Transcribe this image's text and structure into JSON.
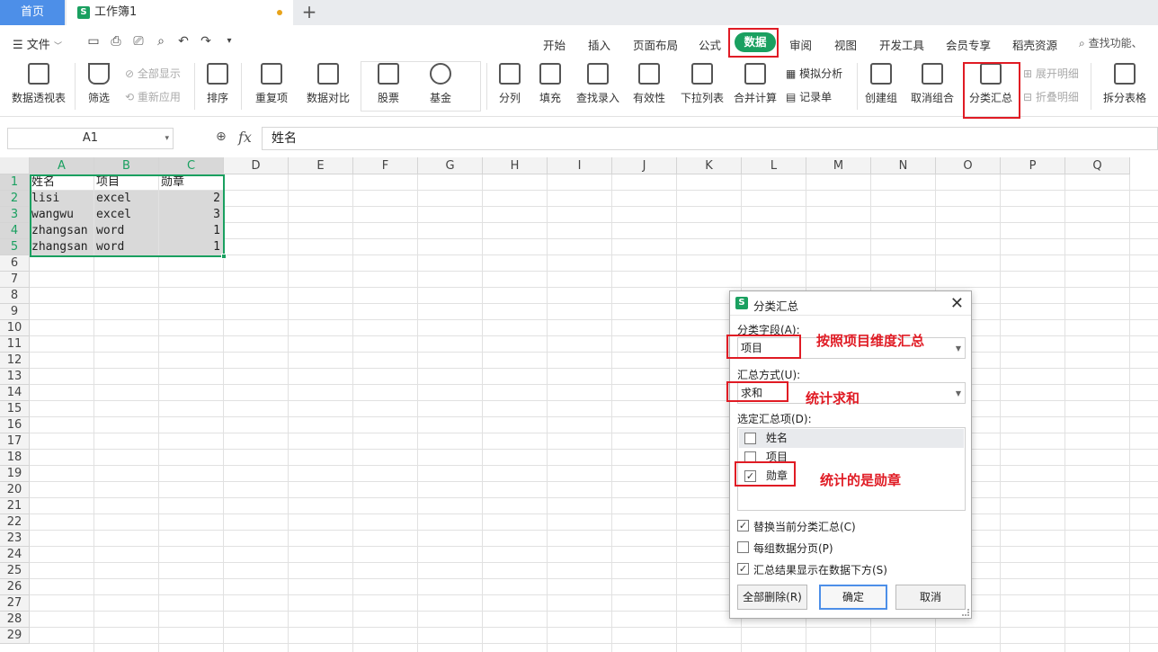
{
  "tabs": {
    "home": "首页",
    "doc": "工作簿1"
  },
  "menu": {
    "file": "文件",
    "tabs": [
      "开始",
      "插入",
      "页面布局",
      "公式",
      "数据",
      "审阅",
      "视图",
      "开发工具",
      "会员专享",
      "稻壳资源"
    ],
    "active_tab": "数据",
    "search": "查找功能、"
  },
  "ribbon": {
    "pivot": "数据透视表",
    "filter": "筛选",
    "show_all": "全部显示",
    "reapply": "重新应用",
    "sort": "排序",
    "dup": "重复项",
    "compare": "数据对比",
    "stock": "股票",
    "fund": "基金",
    "split": "分列",
    "fill": "填充",
    "lookup": "查找录入",
    "validity": "有效性",
    "dropdown": "下拉列表",
    "merge_calc": "合并计算",
    "simulate": "模拟分析",
    "record": "记录单",
    "group": "创建组",
    "ungroup": "取消组合",
    "subtotal": "分类汇总",
    "expand": "展开明细",
    "collapse": "折叠明细",
    "split_table": "拆分表格"
  },
  "formula": {
    "cell_ref": "A1",
    "fx": "fx",
    "value": "姓名"
  },
  "grid": {
    "columns": [
      "A",
      "B",
      "C",
      "D",
      "E",
      "F",
      "G",
      "H",
      "I",
      "J",
      "K",
      "L",
      "M",
      "N",
      "O",
      "P",
      "Q"
    ],
    "rows": [
      "1",
      "2",
      "3",
      "4",
      "5",
      "6",
      "7",
      "8",
      "9",
      "10",
      "11",
      "12",
      "13",
      "14",
      "15",
      "16",
      "17",
      "18",
      "19",
      "20",
      "21",
      "22",
      "23",
      "24",
      "25",
      "26",
      "27",
      "28",
      "29"
    ],
    "data": [
      [
        "姓名",
        "项目",
        "勋章"
      ],
      [
        "lisi",
        "excel",
        "2"
      ],
      [
        "wangwu",
        "excel",
        "3"
      ],
      [
        "zhangsan",
        "word",
        "1"
      ],
      [
        "zhangsan",
        "word",
        "1"
      ]
    ]
  },
  "dialog": {
    "title": "分类汇总",
    "field_label": "分类字段(A):",
    "field_value": "项目",
    "method_label": "汇总方式(U):",
    "method_value": "求和",
    "items_label": "选定汇总项(D):",
    "items": [
      {
        "label": "姓名",
        "checked": false
      },
      {
        "label": "项目",
        "checked": false
      },
      {
        "label": "勋章",
        "checked": true
      }
    ],
    "opt_replace": "替换当前分类汇总(C)",
    "opt_pagebreak": "每组数据分页(P)",
    "opt_below": "汇总结果显示在数据下方(S)",
    "btn_delete_all": "全部删除(R)",
    "btn_ok": "确定",
    "btn_cancel": "取消"
  },
  "annotations": {
    "field": "按照项目维度汇总",
    "method": "统计求和",
    "items": "统计的是勋章"
  },
  "colors": {
    "accent": "#1aa060",
    "highlight": "#e01b24",
    "tab_blue": "#4d8fe8"
  }
}
